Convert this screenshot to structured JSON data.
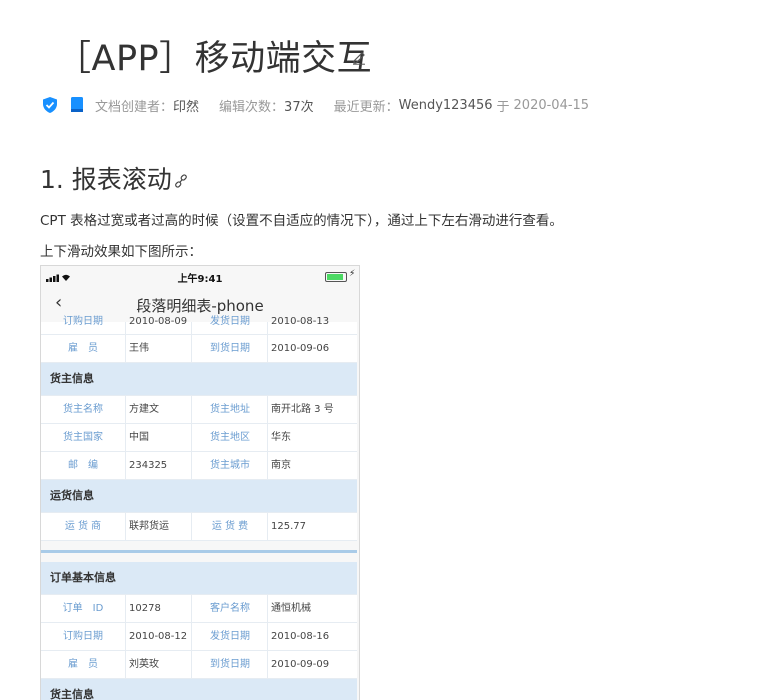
{
  "page": {
    "title": "［APP］移动端交互",
    "meta": {
      "creator_label": "文档创建者：",
      "creator": "印然",
      "edits_label": "编辑次数：",
      "edits": "37次",
      "updated_label": "最近更新：",
      "updater": "Wendy123456",
      "at_word": "于",
      "date": "2020-04-15"
    },
    "section_heading": "1. 报表滚动",
    "paragraph1": "CPT 表格过宽或者过高的时候（设置不自适应的情况下），通过上下左右滑动进行查看。",
    "paragraph2": "上下滑动效果如下图所示："
  },
  "phone": {
    "time": "上午9:41",
    "back_glyph": "‹",
    "nav_title": "段落明细表-phone",
    "rows_top": [
      {
        "k1": "订购日期",
        "v1": "2010-08-09",
        "k2": "发货日期",
        "v2": "2010-08-13"
      },
      {
        "k1": "雇　员",
        "v1": "王伟",
        "k2": "到货日期",
        "v2": "2010-09-06"
      }
    ],
    "section_shipper": "货主信息",
    "rows_shipper": [
      {
        "k1": "货主名称",
        "v1": "方建文",
        "k2": "货主地址",
        "v2": "南开北路 3 号"
      },
      {
        "k1": "货主国家",
        "v1": "中国",
        "k2": "货主地区",
        "v2": "华东"
      },
      {
        "k1": "邮　编",
        "v1": "234325",
        "k2": "货主城市",
        "v2": "南京"
      }
    ],
    "section_shipping": "运货信息",
    "rows_shipping": [
      {
        "k1": "运 货 商",
        "v1": "联邦货运",
        "k2": "运 货 费",
        "v2": "125.77"
      }
    ],
    "section_order": "订单基本信息",
    "rows_order": [
      {
        "k1": "订单　ID",
        "v1": "10278",
        "k2": "客户名称",
        "v2": "通恒机械"
      },
      {
        "k1": "订购日期",
        "v1": "2010-08-12",
        "k2": "发货日期",
        "v2": "2010-08-16"
      },
      {
        "k1": "雇　员",
        "v1": "刘英玫",
        "k2": "到货日期",
        "v2": "2010-09-09"
      }
    ],
    "section_shipper2": "货主信息"
  },
  "colors": {
    "accent": "#1890ff",
    "key_text": "#6a9cd0",
    "section_bg": "#dbe9f6",
    "battery": "#4cd964"
  },
  "icons": [
    "edit-icon",
    "shield-check-icon",
    "document-icon",
    "link-icon",
    "signal-icon",
    "wifi-icon",
    "battery-icon",
    "back-chevron-icon"
  ]
}
